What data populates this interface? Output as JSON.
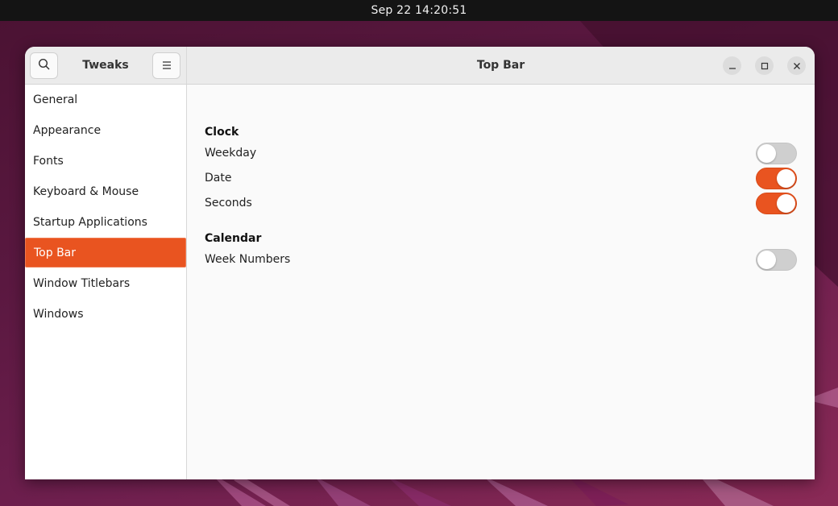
{
  "system": {
    "clock": "Sep 22  14:20:51"
  },
  "window": {
    "app_title": "Tweaks",
    "page_title": "Top Bar",
    "icons": {
      "search": "search-icon",
      "menu": "hamburger-menu-icon",
      "minimize": "minimize-icon",
      "maximize": "maximize-icon",
      "close": "close-icon"
    }
  },
  "sidebar": {
    "items": [
      {
        "label": "General",
        "active": false
      },
      {
        "label": "Appearance",
        "active": false
      },
      {
        "label": "Fonts",
        "active": false
      },
      {
        "label": "Keyboard & Mouse",
        "active": false
      },
      {
        "label": "Startup Applications",
        "active": false
      },
      {
        "label": "Top Bar",
        "active": true
      },
      {
        "label": "Window Titlebars",
        "active": false
      },
      {
        "label": "Windows",
        "active": false
      }
    ]
  },
  "content": {
    "sections": [
      {
        "title": "Clock",
        "rows": [
          {
            "label": "Weekday",
            "enabled": false
          },
          {
            "label": "Date",
            "enabled": true
          },
          {
            "label": "Seconds",
            "enabled": true
          }
        ]
      },
      {
        "title": "Calendar",
        "rows": [
          {
            "label": "Week Numbers",
            "enabled": false
          }
        ]
      }
    ]
  },
  "colors": {
    "accent": "#e95420",
    "switch_off": "#cfcfcf",
    "topbar": "#141414",
    "headerbar": "#ebebeb",
    "content_bg": "#fafafa",
    "sidebar_bg": "#ffffff"
  }
}
